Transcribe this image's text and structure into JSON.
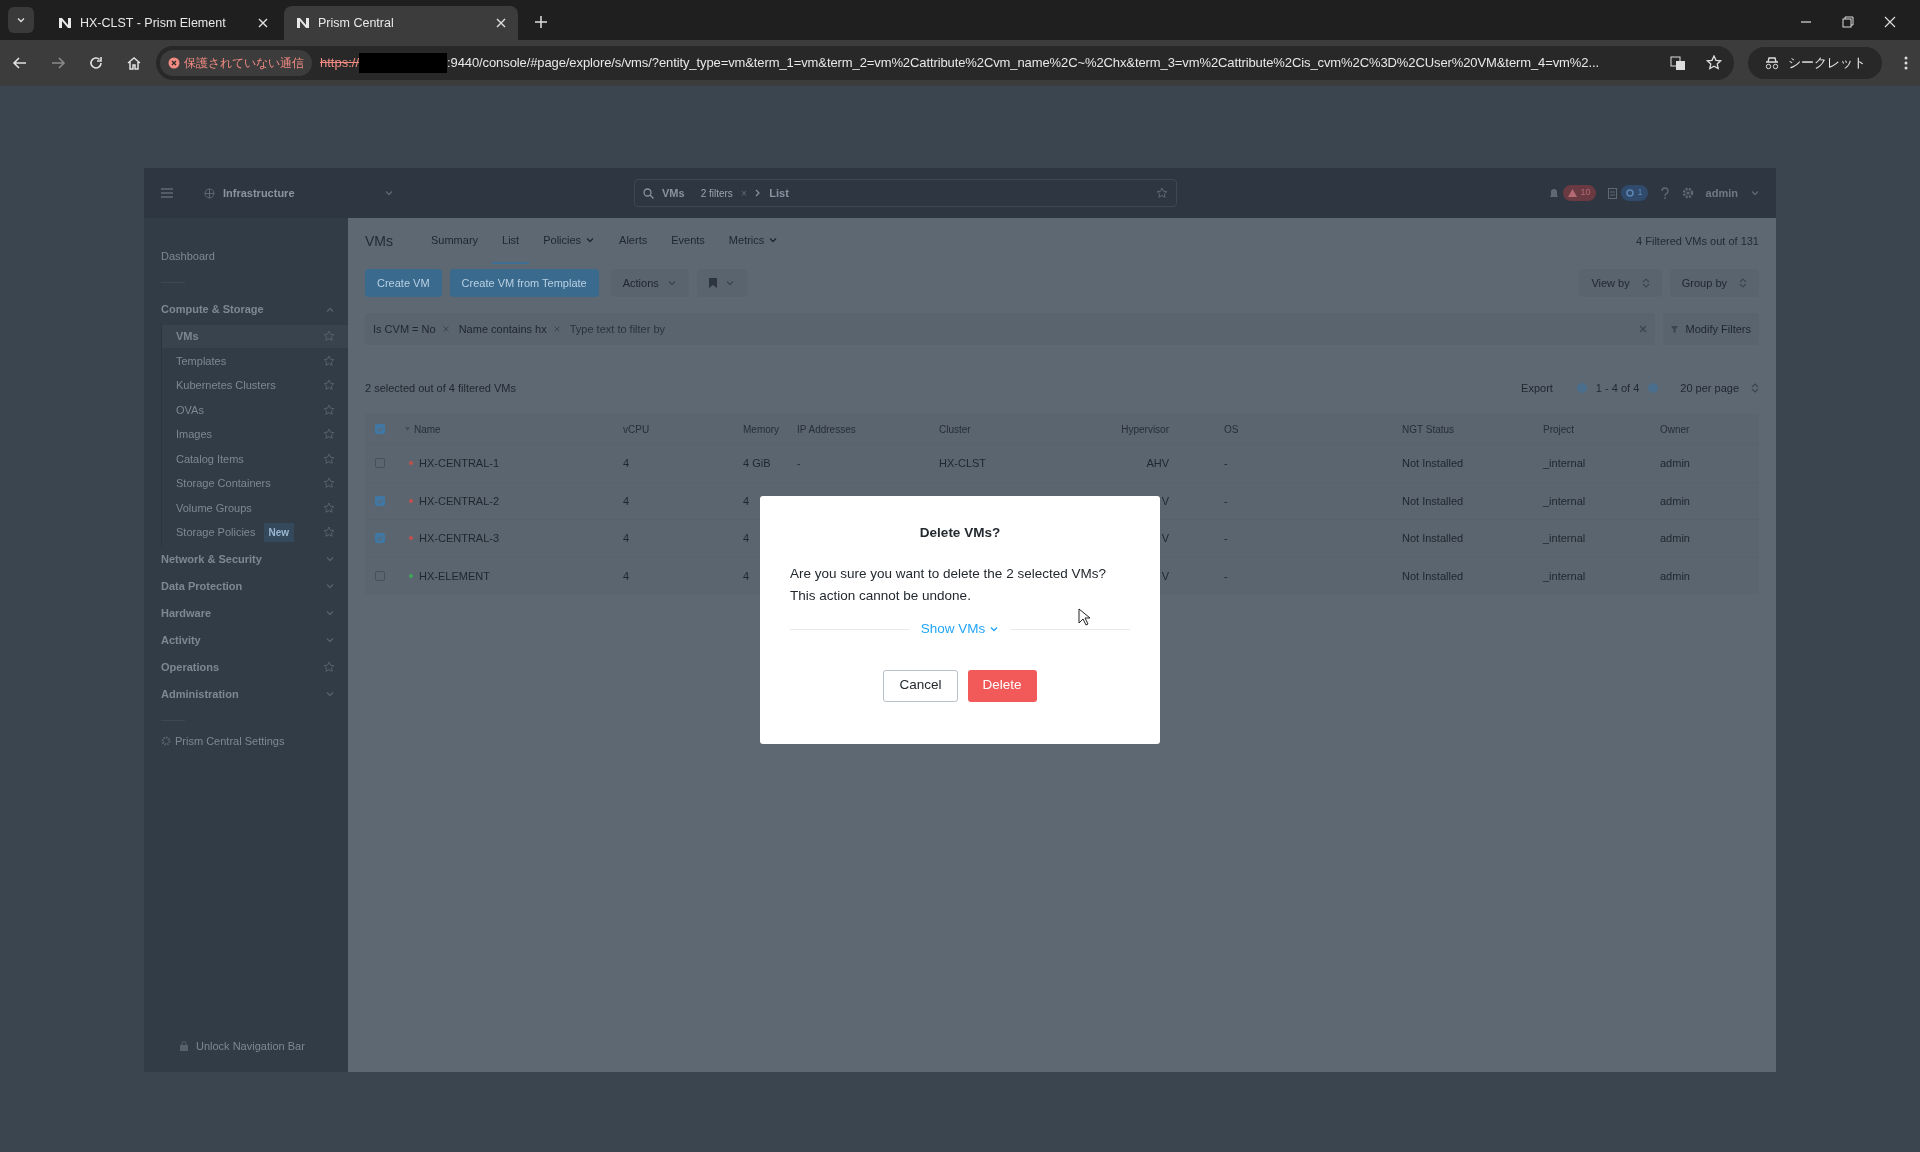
{
  "browser": {
    "tabs": [
      {
        "title": "HX-CLST - Prism Element",
        "selected": false
      },
      {
        "title": "Prism Central",
        "selected": true
      }
    ],
    "security_chip": "保護されていない通信",
    "url_scheme": "https://",
    "url_rest": ":9440/console/#page/explore/s/vms/?entity_type=vm&term_1=vm&term_2=vm%2Cattribute%2Cvm_name%2C~%2Chx&term_3=vm%2Cattribute%2Cis_cvm%2C%3D%2CUser%20VM&term_4=vm%2...",
    "incognito": "シークレット"
  },
  "header": {
    "app": "Infrastructure",
    "search": {
      "entity": "VMs",
      "filters": "2 filters",
      "clear": "×",
      "view": "List"
    },
    "alerts": "10",
    "tasks": "1",
    "user": "admin"
  },
  "sidebar": {
    "items": [
      {
        "label": "Dashboard",
        "kind": "page"
      },
      {
        "label": "Compute & Storage",
        "kind": "group",
        "expanded": true,
        "children": [
          {
            "label": "VMs",
            "selected": true
          },
          {
            "label": "Templates",
            "selected": false
          },
          {
            "label": "Kubernetes Clusters",
            "selected": false
          },
          {
            "label": "OVAs",
            "selected": false
          },
          {
            "label": "Images",
            "selected": false
          },
          {
            "label": "Catalog Items",
            "selected": false
          },
          {
            "label": "Storage Containers",
            "selected": false
          },
          {
            "label": "Volume Groups",
            "selected": false
          },
          {
            "label": "Storage Policies",
            "badge": "New",
            "selected": false
          }
        ]
      },
      {
        "label": "Network & Security",
        "kind": "group",
        "expanded": false
      },
      {
        "label": "Data Protection",
        "kind": "group",
        "expanded": false
      },
      {
        "label": "Hardware",
        "kind": "group",
        "expanded": false
      },
      {
        "label": "Activity",
        "kind": "group",
        "expanded": false
      },
      {
        "label": "Operations",
        "kind": "pinnable"
      },
      {
        "label": "Administration",
        "kind": "group",
        "expanded": false
      }
    ],
    "settings": "Prism Central Settings",
    "unlock": "Unlock Navigation Bar"
  },
  "page": {
    "title": "VMs",
    "tabs": [
      {
        "label": "Summary",
        "selected": false,
        "menu": false
      },
      {
        "label": "List",
        "selected": true,
        "menu": false
      },
      {
        "label": "Policies",
        "selected": false,
        "menu": true
      },
      {
        "label": "Alerts",
        "selected": false,
        "menu": false
      },
      {
        "label": "Events",
        "selected": false,
        "menu": false
      },
      {
        "label": "Metrics",
        "selected": false,
        "menu": true
      }
    ],
    "count": "4 Filtered VMs out of 131",
    "buttons": [
      "Create VM",
      "Create VM from Template"
    ],
    "actions": "Actions",
    "view_by": "View by",
    "group_by": "Group by",
    "filters": [
      "Is CVM = No",
      "Name contains hx"
    ],
    "filter_placeholder": "Type text to filter by",
    "modify_filters": "Modify Filters",
    "selection": "2 selected out of 4 filtered VMs",
    "export": "Export",
    "range": "1 - 4 of 4",
    "per_page": "20 per page"
  },
  "table": {
    "all_checked": true,
    "columns": [
      "Name",
      "vCPU",
      "Memory",
      "IP Addresses",
      "Cluster",
      "Hypervisor",
      "OS",
      "NGT Status",
      "Project",
      "Owner"
    ],
    "rows": [
      {
        "checked": false,
        "color": "#c0504d",
        "cells": [
          "HX-CENTRAL-1",
          "4",
          "4 GiB",
          "-",
          "HX-CLST",
          "AHV",
          "-",
          "Not Installed",
          "_internal",
          "admin"
        ]
      },
      {
        "checked": true,
        "color": "#c0504d",
        "cells": [
          "HX-CENTRAL-2",
          "4",
          "4",
          "",
          "",
          "V",
          "-",
          "Not Installed",
          "_internal",
          "admin"
        ]
      },
      {
        "checked": true,
        "color": "#c0504d",
        "cells": [
          "HX-CENTRAL-3",
          "4",
          "4",
          "",
          "",
          "V",
          "-",
          "Not Installed",
          "_internal",
          "admin"
        ]
      },
      {
        "checked": false,
        "color": "#3fa55a",
        "cells": [
          "HX-ELEMENT",
          "4",
          "4",
          "",
          "",
          "V",
          "-",
          "Not Installed",
          "_internal",
          "admin"
        ]
      }
    ]
  },
  "dialog": {
    "title": "Delete VMs?",
    "message": "Are you sure you want to delete the 2 selected VMs? This action cannot be undone.",
    "toggle": "Show VMs",
    "buttons": [
      {
        "label": "Cancel",
        "kind": "secondary"
      },
      {
        "label": "Delete",
        "kind": "danger"
      }
    ]
  }
}
